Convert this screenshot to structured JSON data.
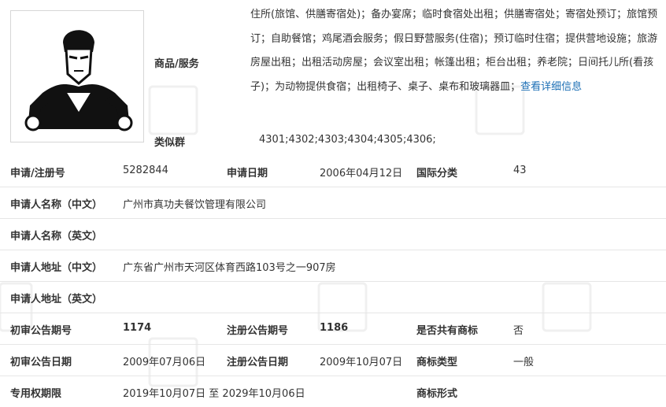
{
  "trademark": {
    "logo_alt": "martial-artist-logo",
    "goods_label": "商品/服务",
    "goods_text": "住所(旅馆、供膳寄宿处)；备办宴席；临时食宿处出租；供膳寄宿处；寄宿处预订；旅馆预订；自助餐馆；鸡尾酒会服务；假日野营服务(住宿)；预订临时住宿；提供营地设施；旅游房屋出租；出租活动房屋；会议室出租；帐篷出租；柜台出租；养老院；日间托儿所(看孩子)；为动物提供食宿；出租椅子、桌子、桌布和玻璃器皿；",
    "goods_link": "查看详细信息",
    "similar_label": "类似群",
    "similar_value": "4301;4302;4303;4304;4305;4306;"
  },
  "rows": {
    "reg_no_label": "申请/注册号",
    "reg_no_value": "5282844",
    "apply_date_label": "申请日期",
    "apply_date_value": "2006年04月12日",
    "intl_class_label": "国际分类",
    "intl_class_value": "43",
    "applicant_cn_label": "申请人名称（中文）",
    "applicant_cn_value": "广州市真功夫餐饮管理有限公司",
    "applicant_en_label": "申请人名称（英文）",
    "applicant_en_value": "",
    "address_cn_label": "申请人地址（中文）",
    "address_cn_value": "广东省广州市天河区体育西路103号之一907房",
    "address_en_label": "申请人地址（英文）",
    "address_en_value": "",
    "prelim_no_label": "初审公告期号",
    "prelim_no_value": "1174",
    "reg_pub_no_label": "注册公告期号",
    "reg_pub_no_value": "1186",
    "shared_label": "是否共有商标",
    "shared_value": "否",
    "prelim_date_label": "初审公告日期",
    "prelim_date_value": "2009年07月06日",
    "reg_pub_date_label": "注册公告日期",
    "reg_pub_date_value": "2009年10月07日",
    "mark_type_label": "商标类型",
    "mark_type_value": "一般",
    "exclusive_label": "专用权期限",
    "exclusive_value": "2019年10月07日 至 2029年10月06日",
    "mark_form_label": "商标形式",
    "mark_form_value": ""
  }
}
